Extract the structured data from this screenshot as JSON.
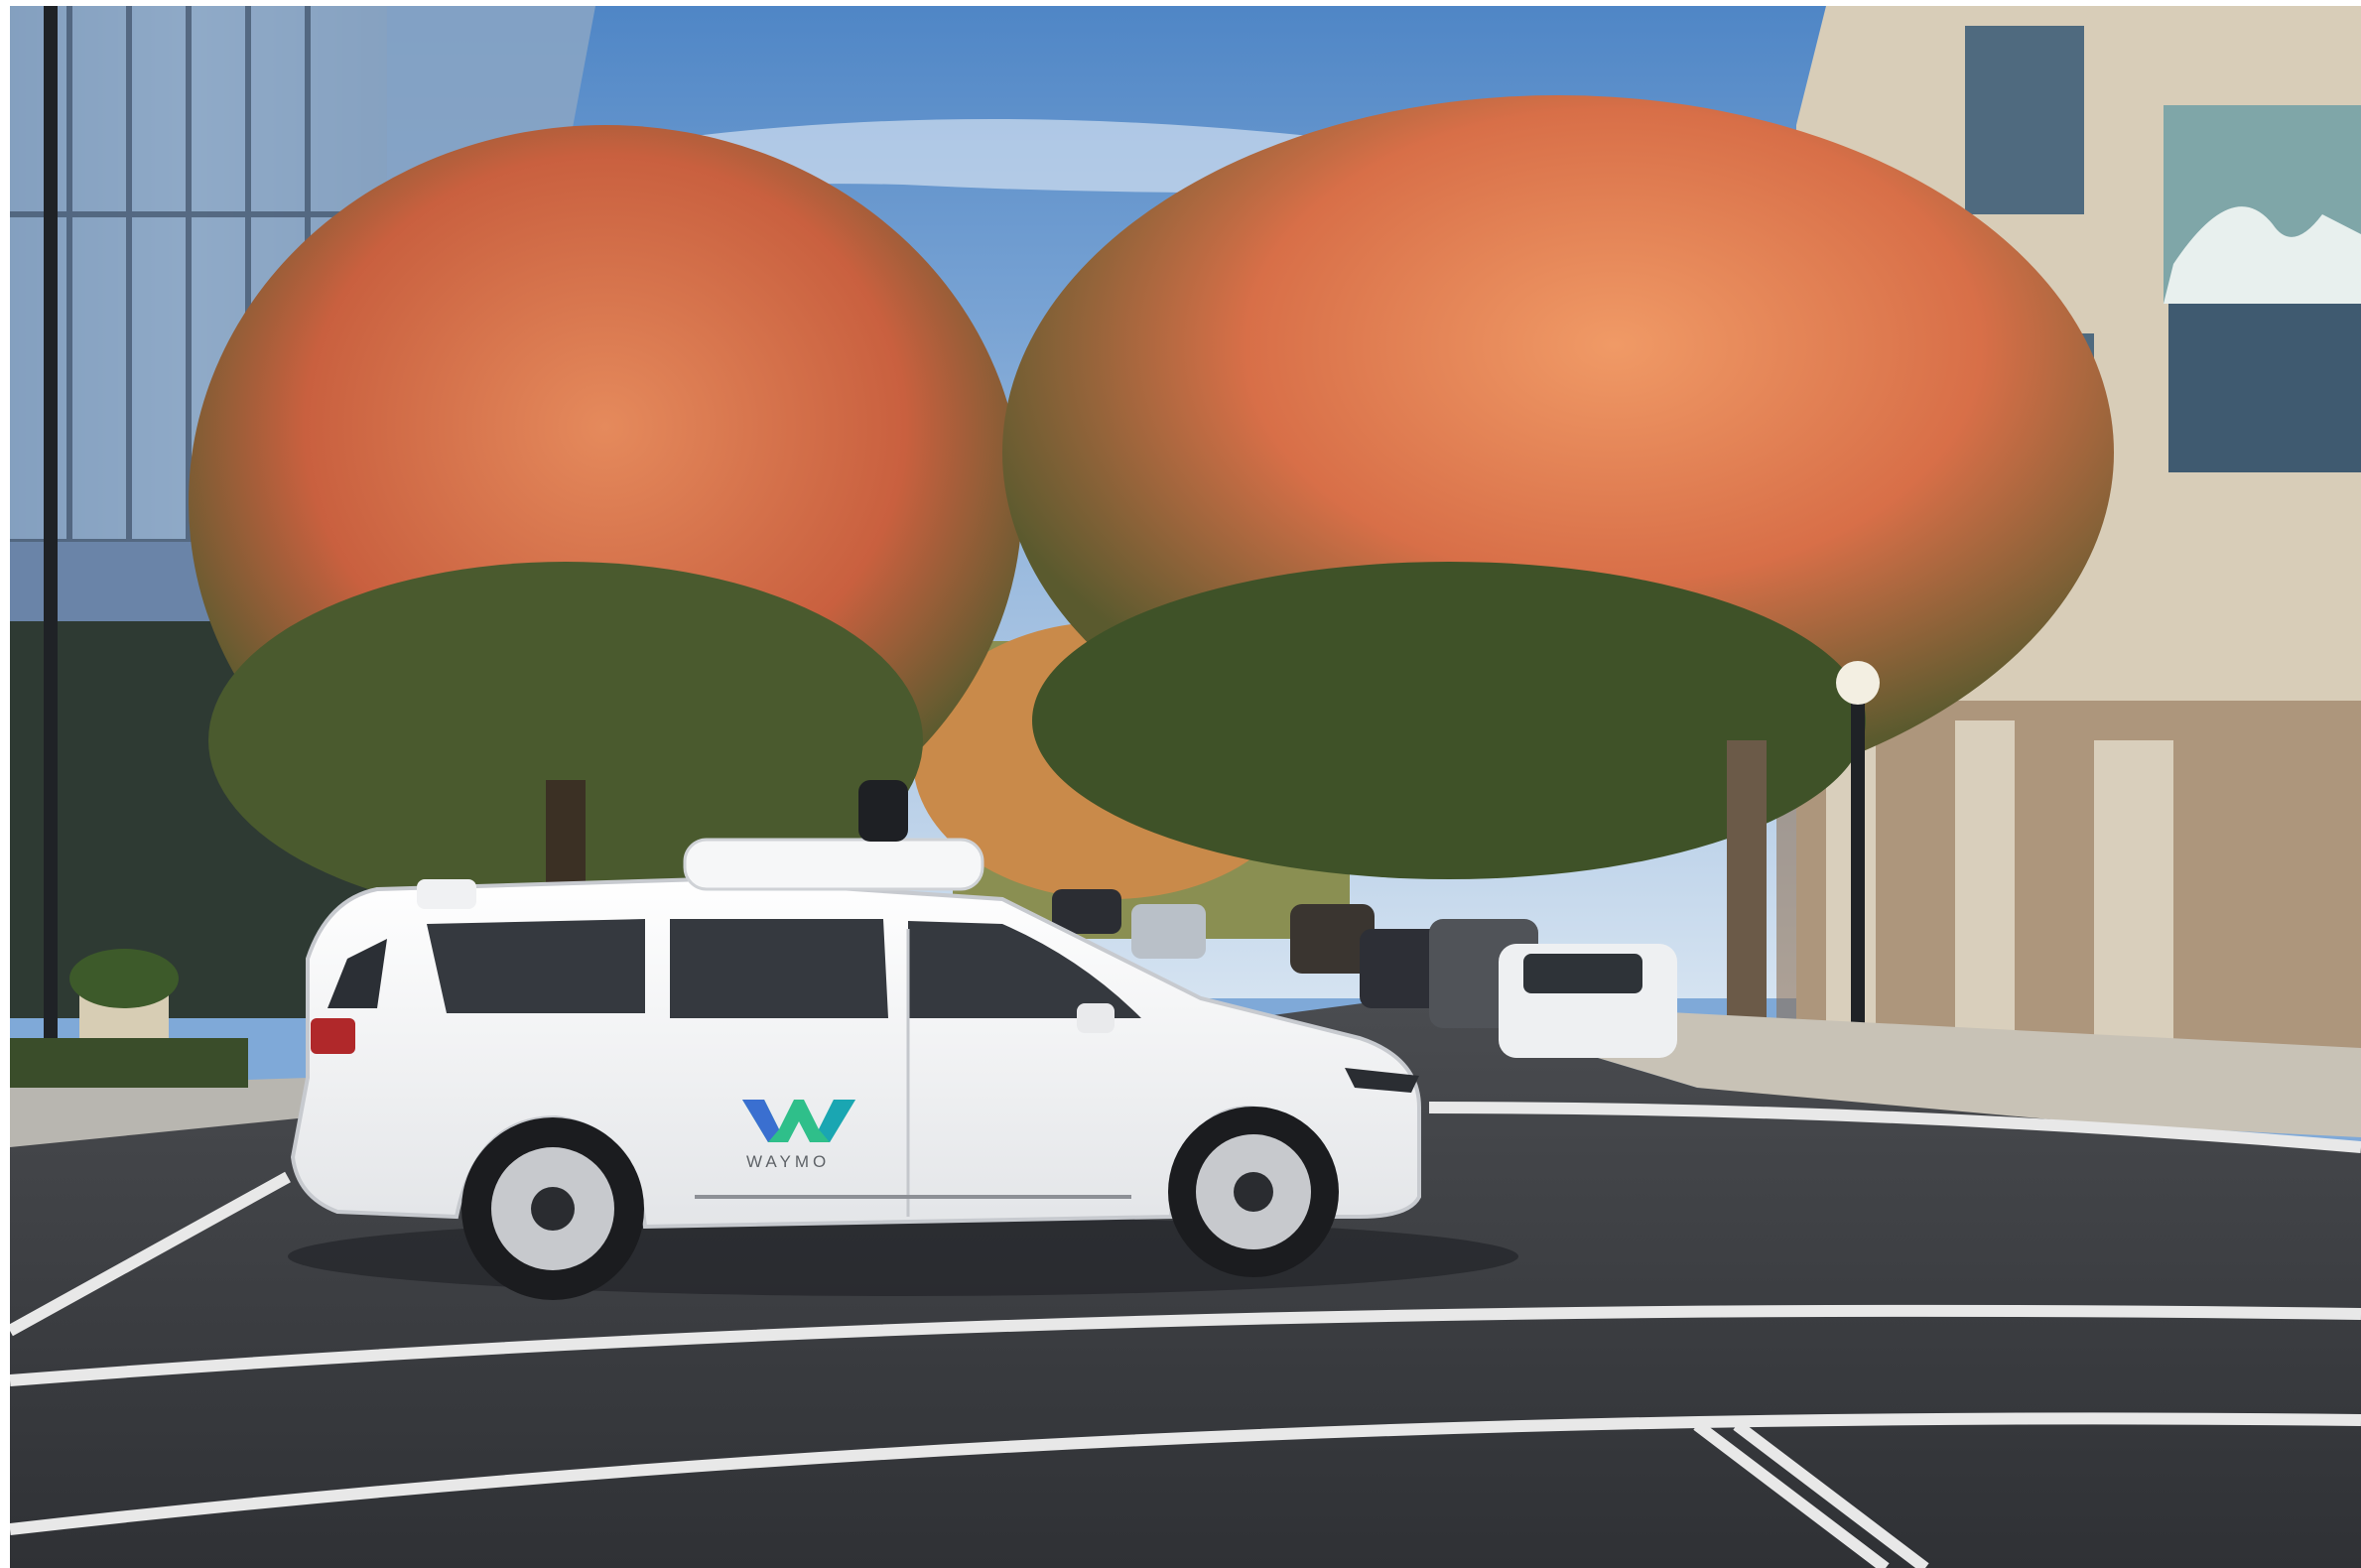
{
  "image": {
    "subject": "self-driving-minivan-at-intersection",
    "season": "autumn"
  },
  "vehicle": {
    "brand_text": "WAYMO",
    "logo_letter": "W",
    "colors": {
      "body": "#f4f5f6",
      "logo_green": "#2fbf8a",
      "logo_blue": "#3a6fd0",
      "logo_teal": "#1aa6b2"
    }
  },
  "palette": {
    "sky_top": "#4f86c6",
    "sky_bottom": "#c9dcef",
    "foliage_orange": "#e07a4e",
    "foliage_red": "#c84f3a",
    "foliage_green": "#3d5a2a",
    "road": "#3a3c40",
    "lane_marking": "#e8e8e8",
    "building_stone": "#d8cdb8",
    "glass_building": "#7c96b4"
  }
}
